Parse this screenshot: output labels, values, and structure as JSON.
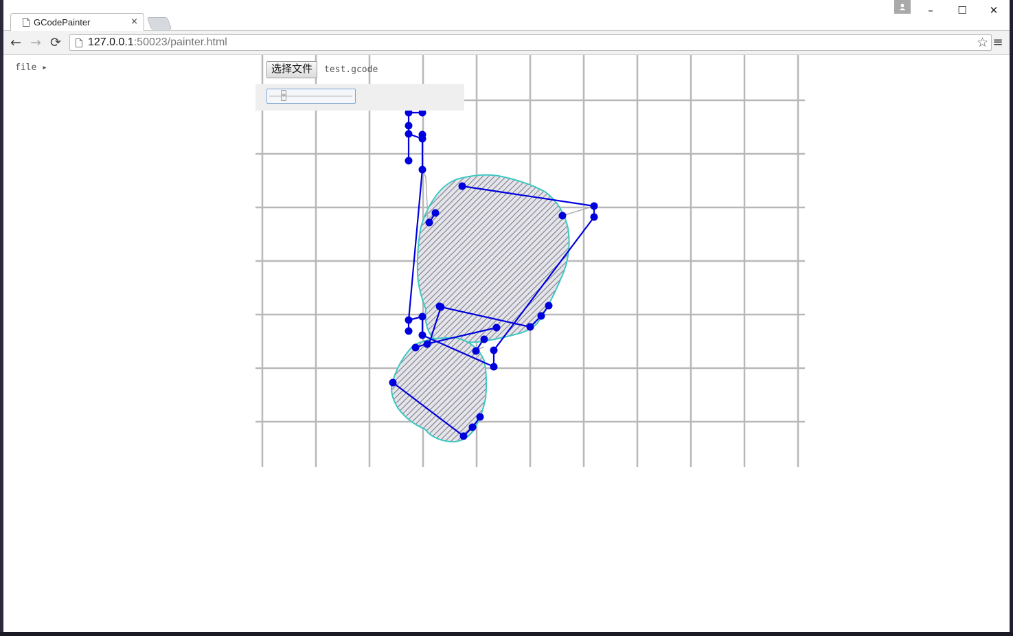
{
  "browser": {
    "tab_title": "GCodePainter",
    "tab_close": "×",
    "url_host": "127.0.0.1",
    "url_rest": ":50023/painter.html",
    "window_controls": {
      "minimize": "–",
      "maximize": "☐",
      "close": "✕"
    },
    "nav": {
      "back": "←",
      "forward": "→",
      "reload": "⟳"
    },
    "star": "☆",
    "menu": "≡"
  },
  "app": {
    "file_menu": "file ▸",
    "choose_file_label": "选择文件",
    "selected_file": "test.gcode",
    "layer_slider_value": 0.15
  },
  "colors": {
    "path": "#0000dd",
    "grid": "#b8b8b8",
    "outline": "#3cc8c0",
    "hatch": "#8a8a96"
  }
}
